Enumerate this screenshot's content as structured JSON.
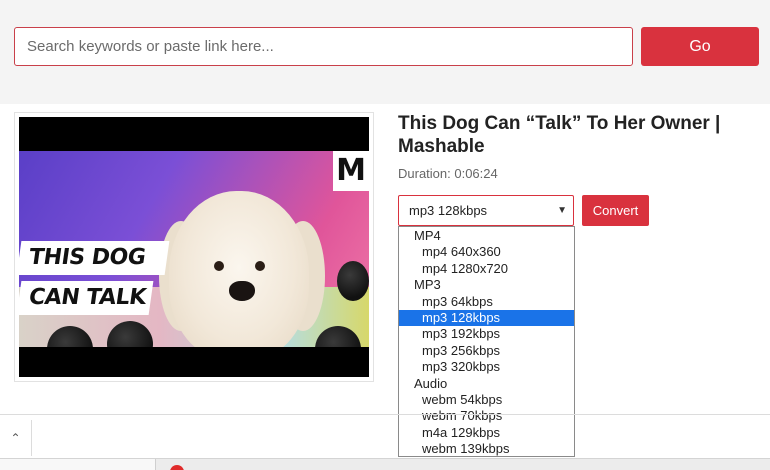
{
  "search": {
    "placeholder": "Search keywords or paste link here...",
    "go_label": "Go"
  },
  "video": {
    "thumbnail_banner_line1": "THIS DOG",
    "thumbnail_banner_line2": "CAN TALK",
    "thumbnail_logo": "M",
    "title": "This Dog Can “Talk” To Her Owner | Mashable",
    "duration": "Duration: 0:06:24"
  },
  "format": {
    "selected": "mp3 128kbps",
    "convert_label": "Convert",
    "groups": [
      {
        "label": "MP4",
        "options": [
          "mp4 640x360",
          "mp4 1280x720"
        ]
      },
      {
        "label": "MP3",
        "options": [
          "mp3 64kbps",
          "mp3 128kbps",
          "mp3 192kbps",
          "mp3 256kbps",
          "mp3 320kbps"
        ]
      },
      {
        "label": "Audio",
        "options": [
          "webm 54kbps",
          "webm 70kbps",
          "m4a 129kbps",
          "webm 139kbps"
        ]
      }
    ]
  },
  "icons": {
    "select_arrow": "chevron-down-icon",
    "collapse": "chevron-up-icon"
  },
  "colors": {
    "accent": "#d9323e",
    "selection": "#1a73e8"
  }
}
